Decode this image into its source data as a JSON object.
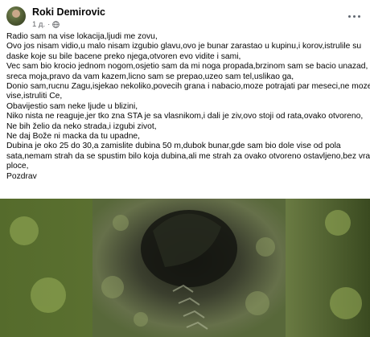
{
  "post": {
    "author": "Roki Demirovic",
    "time": "1 д.",
    "privacy_icon": "globe-icon",
    "more_icon": "more-options-icon",
    "text_lines": [
      "Radio sam na vise lokacija,ljudi me zovu,",
      "Ovo jos nisam vidio,u malo nisam izgubio glavu,ovo je bunar zarastao u kupinu,i korov,istrulile su",
      "daske koje su bile bacene preko njega,otvoren evo vidite i sami,",
      "Vec sam bio krocio jednom nogom,osjetio sam da mi noga propada,brzinom sam se bacio unazad,",
      "sreca moja,pravo da vam kazem,licno sam se prepao,uzeo sam tel,uslikao ga,",
      "Donio sam,rucnu Zagu,isjekao nekoliko,povecih grana i nabacio,moze potrajati par meseci,ne moze",
      "vise,istruliti Ce,",
      "Obavijestio sam neke ljude u blizini,",
      "Niko nista ne reaguje,jer tko zna STA je sa vlasnikom,i dali je ziv,ovo stoji od rata,ovako otvoreno,",
      "Ne bih želio da neko strada,i izgubi zivot,",
      "Ne daj Bože ni macka da tu upadne,",
      "Dubina je oko 25 do 30,a zamislite dubina 50 m,dubok bunar,gde sam bio dole vise od pola",
      "sata,nemam strah da se spustim bilo koja dubina,ali me strah za ovako otvoreno ostavljeno,bez vrata,i",
      "ploce,",
      "Pozdrav"
    ]
  }
}
